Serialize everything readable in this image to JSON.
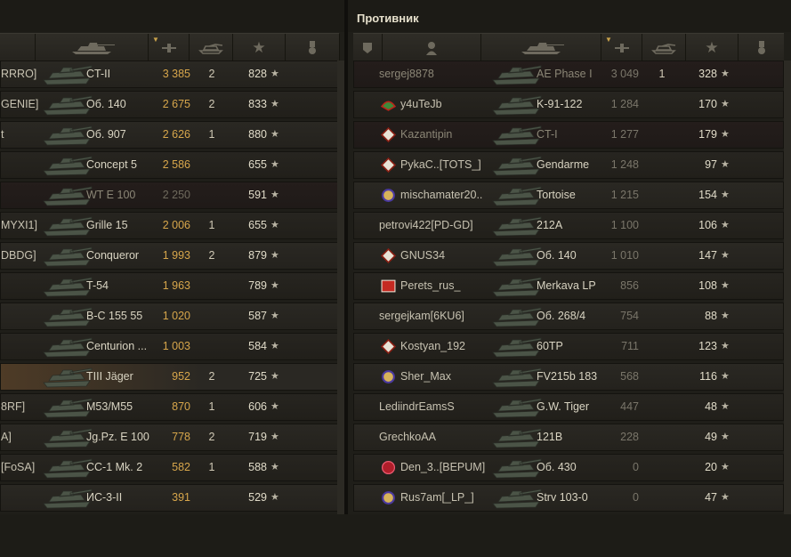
{
  "enemy_team": {
    "title": "Противник",
    "header_icons": [
      "platoon-icon",
      "player-icon",
      "tank-icon",
      "damage-icon",
      "kills-icon",
      "xp-icon",
      "medal-icon"
    ],
    "players": [
      {
        "name": "sergej8878",
        "vehicle": "AE Phase I",
        "damage": "3 049",
        "kills": "1",
        "xp": "328",
        "badge": "",
        "dead": true
      },
      {
        "name": "y4uTeJb",
        "vehicle": "K-91-122",
        "damage": "1 284",
        "kills": "",
        "xp": "170",
        "badge": "clan-badge-green",
        "dead": false
      },
      {
        "name": "Kazantipin",
        "vehicle": "CT-I",
        "damage": "1 277",
        "kills": "",
        "xp": "179",
        "badge": "clan-badge-diamond",
        "dead": true
      },
      {
        "name": "PykaC..[TOTS_]",
        "vehicle": "Gendarme",
        "damage": "1 248",
        "kills": "",
        "xp": "97",
        "badge": "clan-badge-diamond",
        "dead": false
      },
      {
        "name": "mischamater20..",
        "vehicle": "Tortoise",
        "damage": "1 215",
        "kills": "",
        "xp": "154",
        "badge": "clan-badge-cog",
        "dead": false
      },
      {
        "name": "petrovi422[PD-GD]",
        "vehicle": "212A",
        "damage": "1 100",
        "kills": "",
        "xp": "106",
        "badge": "",
        "dead": false
      },
      {
        "name": "GNUS34",
        "vehicle": "Об. 140",
        "damage": "1 010",
        "kills": "",
        "xp": "147",
        "badge": "clan-badge-diamond",
        "dead": false
      },
      {
        "name": "Perets_rus_",
        "vehicle": "Merkava LP",
        "damage": "856",
        "kills": "",
        "xp": "108",
        "badge": "clan-badge-red",
        "dead": false
      },
      {
        "name": "sergejkam[6KU6]",
        "vehicle": "Об. 268/4",
        "damage": "754",
        "kills": "",
        "xp": "88",
        "badge": "",
        "dead": false
      },
      {
        "name": "Kostyan_192",
        "vehicle": "60TP",
        "damage": "711",
        "kills": "",
        "xp": "123",
        "badge": "clan-badge-diamond",
        "dead": false
      },
      {
        "name": "Sher_Max",
        "vehicle": "FV215b 183",
        "damage": "568",
        "kills": "",
        "xp": "116",
        "badge": "clan-badge-cog",
        "dead": false
      },
      {
        "name": "LediindrEamsS",
        "vehicle": "G.W. Tiger",
        "damage": "447",
        "kills": "",
        "xp": "48",
        "badge": "",
        "dead": false
      },
      {
        "name": "GrechkoAA",
        "vehicle": "121B",
        "damage": "228",
        "kills": "",
        "xp": "49",
        "badge": "",
        "dead": false
      },
      {
        "name": "Den_3..[BEPUM]",
        "vehicle": "Об. 430",
        "damage": "0",
        "kills": "",
        "xp": "20",
        "badge": "clan-badge-red-round",
        "dead": false
      },
      {
        "name": "Rus7am[_LP_]",
        "vehicle": "Strv 103-0",
        "damage": "0",
        "kills": "",
        "xp": "47",
        "badge": "clan-badge-cog",
        "dead": false
      }
    ]
  },
  "ally_team": {
    "header_icons": [
      "tank-icon",
      "damage-icon",
      "kills-icon",
      "xp-icon",
      "medal-icon"
    ],
    "players": [
      {
        "name": "RRRO]",
        "vehicle": "CT-II",
        "damage": "3 385",
        "kills": "2",
        "xp": "828",
        "dead": false,
        "me": false
      },
      {
        "name": "GENIE]",
        "vehicle": "Об. 140",
        "damage": "2 675",
        "kills": "2",
        "xp": "833",
        "dead": false,
        "me": false
      },
      {
        "name": "t",
        "vehicle": "Об. 907",
        "damage": "2 626",
        "kills": "1",
        "xp": "880",
        "dead": false,
        "me": false
      },
      {
        "name": "",
        "vehicle": "Concept 5",
        "damage": "2 586",
        "kills": "",
        "xp": "655",
        "dead": false,
        "me": false
      },
      {
        "name": "",
        "vehicle": "WT E 100",
        "damage": "2 250",
        "kills": "",
        "xp": "591",
        "dead": true,
        "me": false
      },
      {
        "name": "MYXI1]",
        "vehicle": "Grille 15",
        "damage": "2 006",
        "kills": "1",
        "xp": "655",
        "dead": false,
        "me": false
      },
      {
        "name": "DBDG]",
        "vehicle": "Conqueror",
        "damage": "1 993",
        "kills": "2",
        "xp": "879",
        "dead": false,
        "me": false
      },
      {
        "name": "",
        "vehicle": "T-54",
        "damage": "1 963",
        "kills": "",
        "xp": "789",
        "dead": false,
        "me": false
      },
      {
        "name": "",
        "vehicle": "B-C 155 55",
        "damage": "1 020",
        "kills": "",
        "xp": "587",
        "dead": false,
        "me": false
      },
      {
        "name": "",
        "vehicle": "Centurion ...",
        "damage": "1 003",
        "kills": "",
        "xp": "584",
        "dead": false,
        "me": false
      },
      {
        "name": "",
        "vehicle": "TIII Jäger",
        "damage": "952",
        "kills": "2",
        "xp": "725",
        "dead": false,
        "me": true
      },
      {
        "name": "8RF]",
        "vehicle": "M53/M55",
        "damage": "870",
        "kills": "1",
        "xp": "606",
        "dead": false,
        "me": false
      },
      {
        "name": "A]",
        "vehicle": "Jg.Pz. E 100",
        "damage": "778",
        "kills": "2",
        "xp": "719",
        "dead": false,
        "me": false
      },
      {
        "name": "[FoSA]",
        "vehicle": "СС-1 Mk. 2",
        "damage": "582",
        "kills": "1",
        "xp": "588",
        "dead": false,
        "me": false
      },
      {
        "name": "",
        "vehicle": "ИС-3-II",
        "damage": "391",
        "kills": "",
        "xp": "529",
        "dead": false,
        "me": false
      }
    ]
  },
  "colors": {
    "damage": "#d7a64b",
    "background": "#1f1e19",
    "accent_me": "#4e3b26"
  }
}
